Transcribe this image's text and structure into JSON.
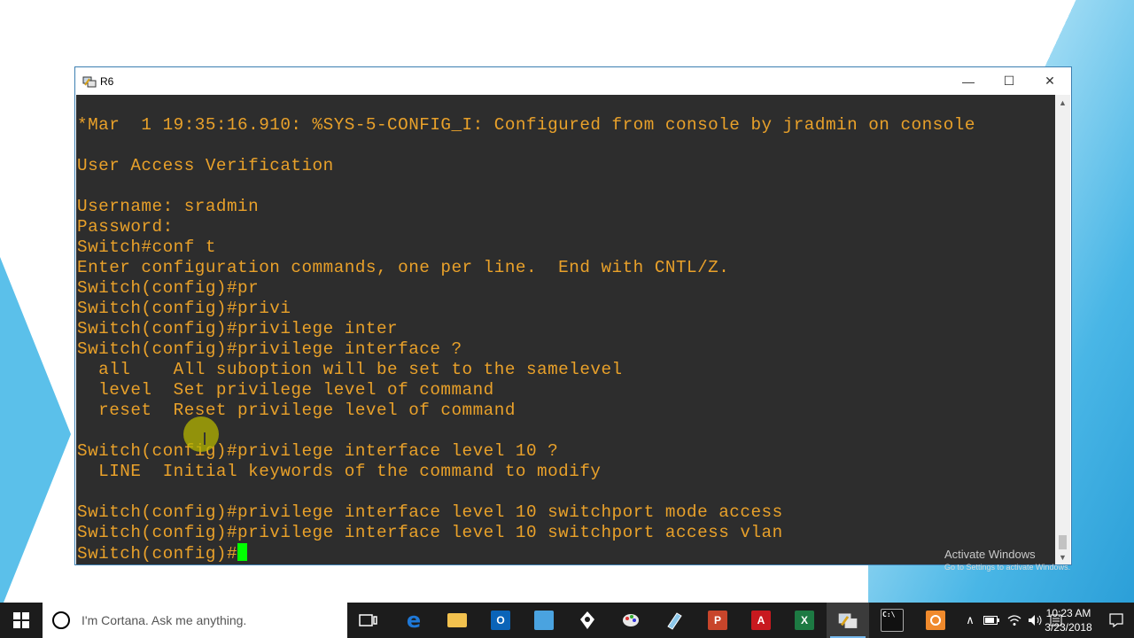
{
  "window": {
    "title": "R6",
    "minimize_glyph": "—",
    "maximize_glyph": "☐",
    "close_glyph": "✕"
  },
  "terminal": {
    "text_color": "#e9a12a",
    "background": "#2d2d2d",
    "lines": [
      "*Mar  1 19:35:16.910: %SYS-5-CONFIG_I: Configured from console by jradmin on console",
      "",
      "User Access Verification",
      "",
      "Username: sradmin",
      "Password:",
      "Switch#conf t",
      "Enter configuration commands, one per line.  End with CNTL/Z.",
      "Switch(config)#pr",
      "Switch(config)#privi",
      "Switch(config)#privilege inter",
      "Switch(config)#privilege interface ?",
      "  all    All suboption will be set to the samelevel",
      "  level  Set privilege level of command",
      "  reset  Reset privilege level of command",
      "",
      "Switch(config)#privilege interface level 10 ?",
      "  LINE  Initial keywords of the command to modify",
      "",
      "Switch(config)#privilege interface level 10 switchport mode access",
      "Switch(config)#privilege interface level 10 switchport access vlan"
    ],
    "prompt": "Switch(config)#"
  },
  "watermark": {
    "title": "Activate Windows",
    "subtitle": "Go to Settings to activate Windows."
  },
  "taskbar": {
    "cortana_placeholder": "I'm Cortana. Ask me anything.",
    "time": "10:23 AM",
    "date": "3/23/2018",
    "apps": [
      {
        "name": "task-view-icon",
        "label": "⧉",
        "color": "#1c1c1c"
      },
      {
        "name": "edge-icon",
        "label": "e",
        "color": "#1e78d7"
      },
      {
        "name": "file-explorer-icon",
        "label": "",
        "color": "#f2c14e"
      },
      {
        "name": "outlook-icon",
        "label": "O",
        "color": "#0a64b8"
      },
      {
        "name": "network-monitor-icon",
        "label": "",
        "color": "#4aa3e0"
      },
      {
        "name": "pen-tool-icon",
        "label": "",
        "color": "#f0f0f0"
      },
      {
        "name": "paint-icon",
        "label": "",
        "color": "#e8e8e8"
      },
      {
        "name": "notepad-icon",
        "label": "",
        "color": "#8cc8ea"
      },
      {
        "name": "powerpoint-icon",
        "label": "P",
        "color": "#c8452b"
      },
      {
        "name": "acrobat-icon",
        "label": "A",
        "color": "#c8191f"
      },
      {
        "name": "excel-icon",
        "label": "X",
        "color": "#1d7a43"
      },
      {
        "name": "putty-icon",
        "label": "",
        "color": "#6a8fb0"
      },
      {
        "name": "command-prompt-icon",
        "label": "C:\\",
        "color": "#111111"
      },
      {
        "name": "recorder-icon",
        "label": "",
        "color": "#f08a2c"
      }
    ]
  }
}
